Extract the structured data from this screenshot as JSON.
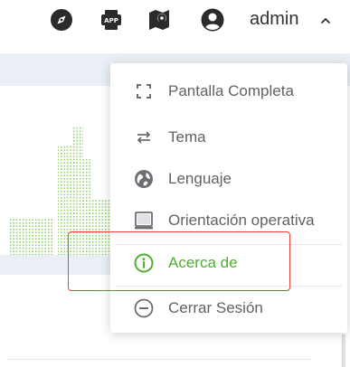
{
  "header": {
    "user_name": "admin",
    "icons": [
      "compass-icon",
      "app-download-icon",
      "map-pin-icon",
      "user-avatar-icon",
      "chevron-up-icon"
    ]
  },
  "menu": {
    "items": [
      {
        "label": "Pantalla Completa",
        "icon": "fullscreen-icon"
      },
      {
        "label": "Tema",
        "icon": "swap-icon"
      },
      {
        "label": "Lenguaje",
        "icon": "globe-icon"
      },
      {
        "label": "Orientación operativa",
        "icon": "monitor-icon"
      },
      {
        "label": "Acerca de",
        "icon": "info-icon",
        "active": true
      },
      {
        "label": "Cerrar Sesión",
        "icon": "logout-icon"
      }
    ]
  },
  "colors": {
    "accent": "#4caf2f",
    "highlight": "#e8433f",
    "text": "#606266"
  }
}
